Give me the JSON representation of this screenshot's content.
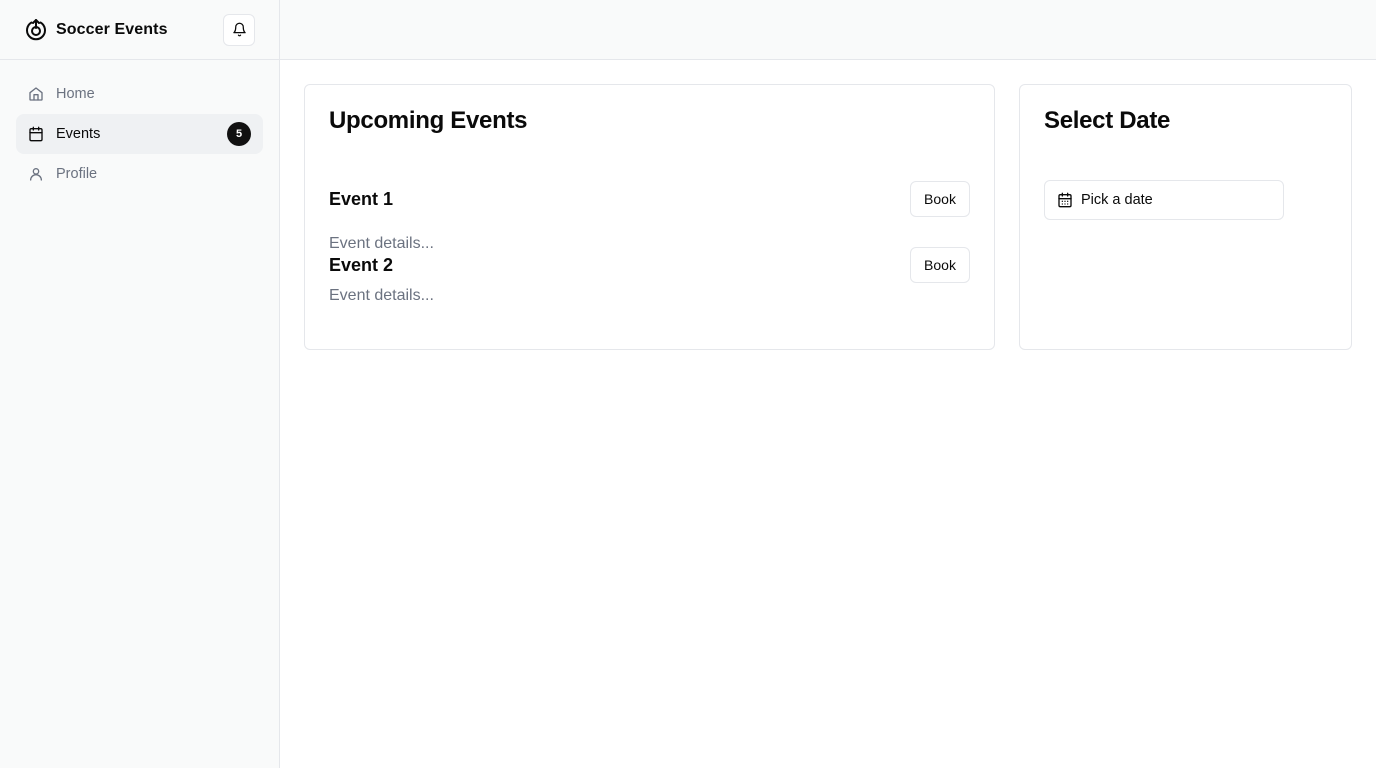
{
  "app": {
    "title": "Soccer Events",
    "logo_icon": "refresh-cw-target-icon",
    "notification_icon": "bell-icon"
  },
  "sidebar": {
    "items": [
      {
        "label": "Home",
        "icon": "home-icon",
        "active": false
      },
      {
        "label": "Events",
        "icon": "calendar-icon",
        "active": true,
        "badge": "5"
      },
      {
        "label": "Profile",
        "icon": "user-icon",
        "active": false
      }
    ]
  },
  "events_card": {
    "title": "Upcoming Events",
    "events": [
      {
        "name": "Event 1",
        "details": "Event details...",
        "button_label": "Book"
      },
      {
        "name": "Event 2",
        "details": "Event details...",
        "button_label": "Book"
      }
    ]
  },
  "date_card": {
    "title": "Select Date",
    "picker_placeholder": "Pick a date",
    "picker_icon": "calendar-icon"
  },
  "colors": {
    "sidebar_bg": "#f9fafa",
    "border": "#e5e7eb",
    "muted_text": "#6b7280",
    "active_bg": "#eff1f3",
    "badge_bg": "#111111"
  }
}
